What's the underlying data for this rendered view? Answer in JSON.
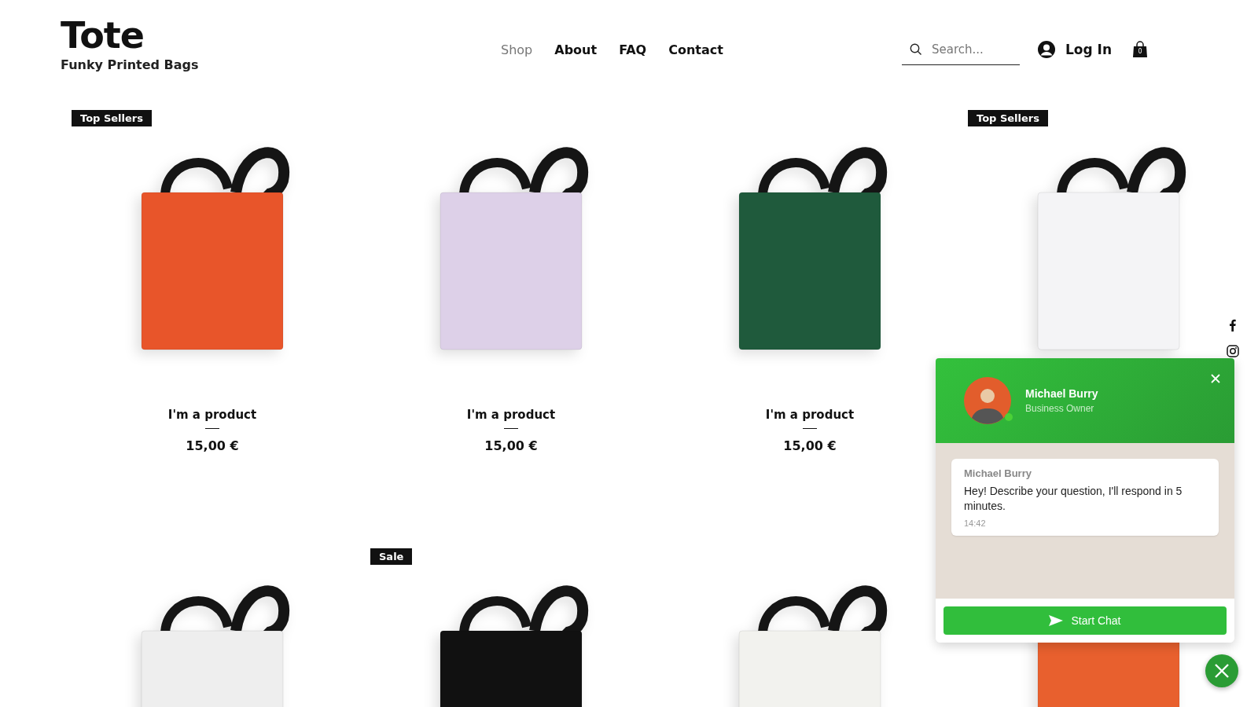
{
  "header": {
    "logo": "Tote",
    "tagline": "Funky Printed Bags",
    "nav": [
      {
        "label": "Shop",
        "selected": true
      },
      {
        "label": "About",
        "selected": false
      },
      {
        "label": "FAQ",
        "selected": false
      },
      {
        "label": "Contact",
        "selected": false
      }
    ],
    "search": {
      "placeholder": "Search..."
    },
    "login": "Log In",
    "cart_count": "0"
  },
  "products": [
    {
      "badge": "Top Sellers",
      "name": "I'm a product",
      "price": "15,00 €",
      "color": "#e8552a"
    },
    {
      "name": "I'm a product",
      "price": "15,00 €",
      "color": "#ddd0e8"
    },
    {
      "name": "I'm a product",
      "price": "15,00 €",
      "color": "#1f5a3c"
    },
    {
      "badge": "Top Sellers",
      "color": "#f4f4f6"
    },
    {
      "color": "#eeeeee"
    },
    {
      "badge": "Sale",
      "color": "#111111"
    },
    {
      "color": "#f2f2ee"
    },
    {
      "color": "#e8602e"
    }
  ],
  "chat": {
    "agent": "Michael Burry",
    "role": "Business Owner",
    "online": true,
    "message": {
      "sender": "Michael Burry",
      "text": "Hey! Describe your question, I'll respond in 5 minutes.",
      "time": "14:42"
    },
    "button": "Start Chat"
  }
}
